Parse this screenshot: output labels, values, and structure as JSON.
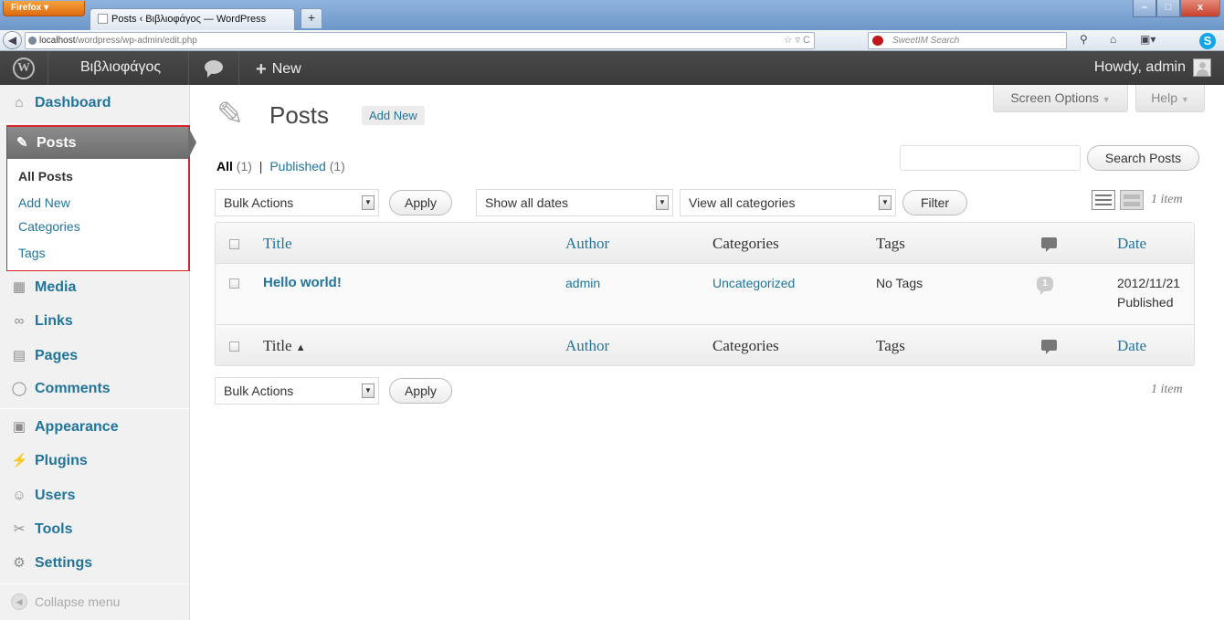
{
  "browser": {
    "app_button": "Firefox",
    "tab_title": "Posts ‹ Βιβλιοφάγος — WordPress",
    "new_tab": "+",
    "url_host": "localhost",
    "url_path": "/wordpress/wp-admin/edit.php",
    "search_placeholder": "SweetIM Search"
  },
  "adminbar": {
    "site_name": "Βιβλιοφάγος",
    "new_label": "New",
    "howdy": "Howdy, admin"
  },
  "sidebar": {
    "items": [
      {
        "label": "Dashboard",
        "icon": "home-icon"
      },
      {
        "label": "Posts",
        "icon": "pushpin-icon"
      },
      {
        "label": "Media",
        "icon": "media-icon"
      },
      {
        "label": "Links",
        "icon": "link-icon"
      },
      {
        "label": "Pages",
        "icon": "pages-icon"
      },
      {
        "label": "Comments",
        "icon": "comment-icon"
      },
      {
        "label": "Appearance",
        "icon": "appearance-icon"
      },
      {
        "label": "Plugins",
        "icon": "plugin-icon"
      },
      {
        "label": "Users",
        "icon": "users-icon"
      },
      {
        "label": "Tools",
        "icon": "tools-icon"
      },
      {
        "label": "Settings",
        "icon": "settings-icon"
      }
    ],
    "submenu": [
      "All Posts",
      "Add New",
      "Categories",
      "Tags"
    ],
    "collapse": "Collapse menu",
    "highlight_color": "#d8232a"
  },
  "screen": {
    "screen_options": "Screen Options",
    "help": "Help"
  },
  "page": {
    "title": "Posts",
    "add_new": "Add New",
    "filter_all": "All",
    "filter_all_count": "(1)",
    "filter_sep": "|",
    "filter_published": "Published",
    "filter_published_count": "(1)",
    "search_button": "Search Posts",
    "bulk_actions": "Bulk Actions",
    "apply": "Apply",
    "dates": "Show all dates",
    "categories": "View all categories",
    "filter": "Filter",
    "items_count": "1 item"
  },
  "table": {
    "columns": {
      "title": "Title",
      "author": "Author",
      "categories": "Categories",
      "tags": "Tags",
      "date": "Date"
    },
    "sort_arrow": "▲",
    "rows": [
      {
        "title": "Hello world!",
        "author": "admin",
        "categories": "Uncategorized",
        "tags": "No Tags",
        "comments": "1",
        "date": "2012/11/21",
        "status": "Published"
      }
    ]
  }
}
